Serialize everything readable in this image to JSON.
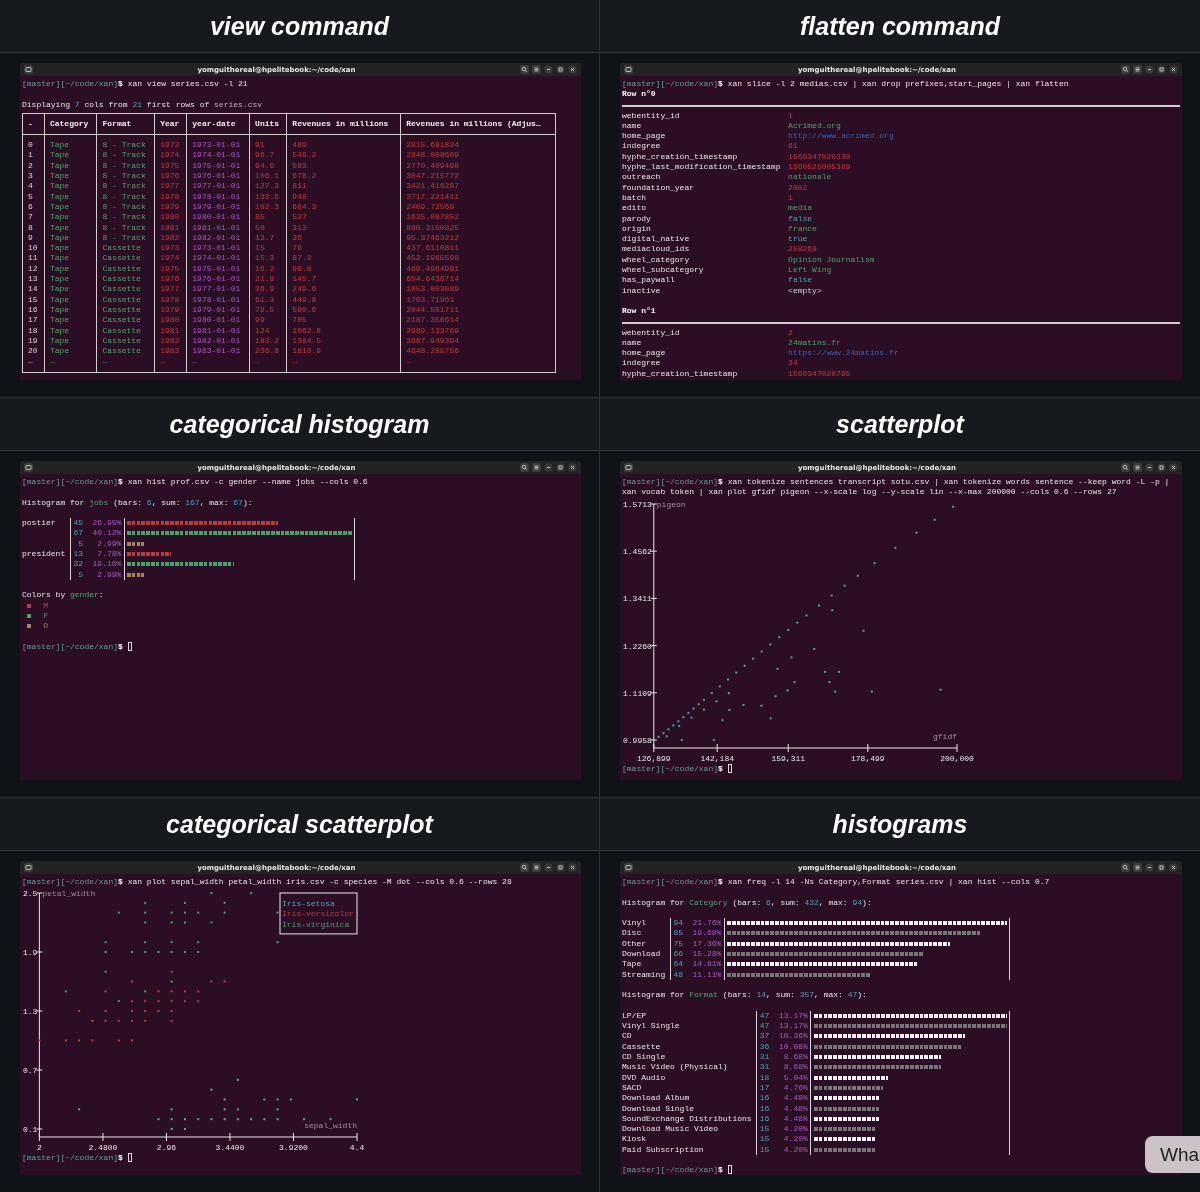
{
  "panels": [
    {
      "title": "view command",
      "terminal": {
        "title": "yomguithereal@hpelitebook:~/code/xan",
        "prompt": "[master][~/code/xan]$",
        "command": "xan view series.csv -l 21",
        "blocks": [
          {
            "kind": "text",
            "segments": [
              {
                "text": "Displaying ",
                "kind": "plain"
              },
              {
                "text": "7",
                "kind": "number"
              },
              {
                "text": " cols from ",
                "kind": "plain"
              },
              {
                "text": "21",
                "kind": "number"
              },
              {
                "text": " first rows of ",
                "kind": "plain"
              },
              {
                "text": "series.csv",
                "kind": "file"
              }
            ]
          },
          {
            "kind": "table",
            "columns": [
              {
                "header": "-",
                "kind": "index"
              },
              {
                "header": "Category",
                "kind": "string"
              },
              {
                "header": "Format",
                "kind": "string"
              },
              {
                "header": "Year",
                "kind": "int"
              },
              {
                "header": "year-date",
                "kind": "date"
              },
              {
                "header": "Units",
                "kind": "int"
              },
              {
                "header": "Revenues in millions",
                "kind": "int"
              },
              {
                "header": "Revenues in millions (Adjus…",
                "kind": "int"
              }
            ],
            "rows": [
              [
                "0",
                "Tape",
                "8 - Track",
                "1973",
                "1973-01-01",
                "91",
                "489",
                "2815.681824"
              ],
              [
                "1",
                "Tape",
                "8 - Track",
                "1974",
                "1974-01-01",
                "96.7",
                "549.2",
                "2848.008609"
              ],
              [
                "2",
                "Tape",
                "8 - Track",
                "1975",
                "1975-01-01",
                "94.6",
                "583",
                "2770.409498"
              ],
              [
                "3",
                "Tape",
                "8 - Track",
                "1976",
                "1976-01-01",
                "106.1",
                "678.2",
                "3047.215772"
              ],
              [
                "4",
                "Tape",
                "8 - Track",
                "1977",
                "1977-01-01",
                "127.3",
                "811",
                "3421.416287"
              ],
              [
                "5",
                "Tape",
                "8 - Track",
                "1978",
                "1978-01-01",
                "133.6",
                "948",
                "3717.221411"
              ],
              [
                "6",
                "Tape",
                "8 - Track",
                "1979",
                "1979-01-01",
                "102.3",
                "684.3",
                "2409.72569"
              ],
              [
                "7",
                "Tape",
                "8 - Track",
                "1980",
                "1980-01-01",
                "85",
                "527",
                "1635.087852"
              ],
              [
                "8",
                "Tape",
                "8 - Track",
                "1981",
                "1981-01-01",
                "50",
                "313",
                "880.3150825"
              ],
              [
                "9",
                "Tape",
                "8 - Track",
                "1982",
                "1982-01-01",
                "13.7",
                "36",
                "95.37463212"
              ],
              [
                "10",
                "Tape",
                "Cassette",
                "1973",
                "1973-01-01",
                "15",
                "76",
                "437.6110811"
              ],
              [
                "11",
                "Tape",
                "Cassette",
                "1974",
                "1974-01-01",
                "15.3",
                "87.2",
                "452.1965598"
              ],
              [
                "12",
                "Tape",
                "Cassette",
                "1975",
                "1975-01-01",
                "16.2",
                "98.8",
                "469.4964981"
              ],
              [
                "13",
                "Tape",
                "Cassette",
                "1976",
                "1976-01-01",
                "21.8",
                "145.7",
                "654.6436714"
              ],
              [
                "14",
                "Tape",
                "Cassette",
                "1977",
                "1977-01-01",
                "36.9",
                "249.6",
                "1053.003089"
              ],
              [
                "15",
                "Tape",
                "Cassette",
                "1978",
                "1978-01-01",
                "61.3",
                "449.8",
                "1763.71961"
              ],
              [
                "16",
                "Tape",
                "Cassette",
                "1979",
                "1979-01-01",
                "78.5",
                "580.6",
                "2044.551711"
              ],
              [
                "17",
                "Tape",
                "Cassette",
                "1980",
                "1980-01-01",
                "99",
                "705",
                "2187.356614"
              ],
              [
                "18",
                "Tape",
                "Cassette",
                "1981",
                "1981-01-01",
                "124",
                "1062.8",
                "2989.133769"
              ],
              [
                "19",
                "Tape",
                "Cassette",
                "1982",
                "1982-01-01",
                "183.2",
                "1384.5",
                "3667.949394"
              ],
              [
                "20",
                "Tape",
                "Cassette",
                "1983",
                "1983-01-01",
                "236.8",
                "1810.9",
                "4648.285756"
              ],
              [
                "…",
                "…",
                "…",
                "…",
                "…",
                "…",
                "…",
                "…"
              ]
            ]
          }
        ]
      }
    },
    {
      "title": "flatten command",
      "terminal": {
        "title": "yomguithereal@hpelitebook:~/code/xan",
        "prompt": "[master][~/code/xan]$",
        "command": "xan slice -l 2 medias.csv | xan drop prefixes,start_pages | xan flatten",
        "blocks": [
          {
            "kind": "record",
            "title": "Row n°0",
            "fields": [
              {
                "key": "webentity_id",
                "value": "1",
                "kind": "int"
              },
              {
                "key": "name",
                "value": "Acrimed.org",
                "kind": "string"
              },
              {
                "key": "home_page",
                "value": "http://www.acrimed.org",
                "kind": "url"
              },
              {
                "key": "indegree",
                "value": "61",
                "kind": "int"
              },
              {
                "key": "hyphe_creation_timestamp",
                "value": "1560347020330",
                "kind": "int"
              },
              {
                "key": "hyphe_last_modification_timestamp",
                "value": "1560526005389",
                "kind": "int"
              },
              {
                "key": "outreach",
                "value": "nationale",
                "kind": "string"
              },
              {
                "key": "foundation_year",
                "value": "2002",
                "kind": "int"
              },
              {
                "key": "batch",
                "value": "1",
                "kind": "int"
              },
              {
                "key": "edito",
                "value": "media",
                "kind": "string"
              },
              {
                "key": "parody",
                "value": "false",
                "kind": "bool"
              },
              {
                "key": "origin",
                "value": "france",
                "kind": "string"
              },
              {
                "key": "digital_native",
                "value": "true",
                "kind": "bool"
              },
              {
                "key": "mediacloud_ids",
                "value": "258269",
                "kind": "int"
              },
              {
                "key": "wheel_category",
                "value": "Opinion Journalism",
                "kind": "string"
              },
              {
                "key": "wheel_subcategory",
                "value": "Left Wing",
                "kind": "string"
              },
              {
                "key": "has_paywall",
                "value": "false",
                "kind": "bool"
              },
              {
                "key": "inactive",
                "value": "<empty>",
                "kind": "empty"
              }
            ]
          },
          {
            "kind": "record",
            "title": "Row n°1",
            "fields": [
              {
                "key": "webentity_id",
                "value": "2",
                "kind": "int"
              },
              {
                "key": "name",
                "value": "24matins.fr",
                "kind": "string"
              },
              {
                "key": "home_page",
                "value": "https://www.24matins.fr",
                "kind": "url"
              },
              {
                "key": "indegree",
                "value": "34",
                "kind": "int"
              },
              {
                "key": "hyphe_creation_timestamp",
                "value": "1560347020795",
                "kind": "int"
              }
            ]
          }
        ]
      }
    },
    {
      "title": "categorical histogram",
      "terminal": {
        "title": "yomguithereal@hpelitebook:~/code/xan",
        "prompt": "[master][~/code/xan]$",
        "command": "xan hist prof.csv -c gender --name jobs --cols 0.6",
        "blocks": [
          {
            "kind": "histogram",
            "heading": [
              {
                "text": "Histogram for ",
                "kind": "plain"
              },
              {
                "text": "jobs",
                "kind": "name"
              },
              {
                "text": " (bars: ",
                "kind": "plain"
              },
              {
                "text": "6",
                "kind": "number"
              },
              {
                "text": ", sum: ",
                "kind": "plain"
              },
              {
                "text": "167",
                "kind": "number"
              },
              {
                "text": ", max: ",
                "kind": "plain"
              },
              {
                "text": "67",
                "kind": "number"
              },
              {
                "text": "):",
                "kind": "plain"
              }
            ],
            "rows": [
              {
                "label": "postier",
                "count": "45",
                "percent": "26.95%",
                "level": 0.672,
                "color": "#c0393b"
              },
              {
                "count": "67",
                "percent": "40.12%",
                "level": 1,
                "color": "#3fa56b"
              },
              {
                "count": "5",
                "percent": "2.99%",
                "level": 0.075,
                "color": "#a88456"
              },
              {
                "label": "president",
                "count": "13",
                "percent": "7.78%",
                "level": 0.194,
                "color": "#c0393b"
              },
              {
                "count": "32",
                "percent": "19.16%",
                "level": 0.478,
                "color": "#3fa56b"
              },
              {
                "count": "5",
                "percent": "2.99%",
                "level": 0.075,
                "color": "#a88456"
              }
            ]
          },
          {
            "kind": "legend",
            "heading": [
              {
                "text": "Colors by ",
                "kind": "plain"
              },
              {
                "text": "gender",
                "kind": "name"
              },
              {
                "text": ":",
                "kind": "plain"
              }
            ],
            "items": [
              {
                "label": "M",
                "color": "#c0393b"
              },
              {
                "label": "F",
                "color": "#3fa56b"
              },
              {
                "label": "O",
                "color": "#a88456"
              }
            ]
          },
          {
            "kind": "prompt",
            "prompt": "[master][~/code/xan]$"
          }
        ]
      }
    },
    {
      "title": "scatterplot",
      "terminal": {
        "title": "yomguithereal@hpelitebook:~/code/xan",
        "prompt": "[master][~/code/xan]$",
        "command": "xan tokenize sentences transcript sotu.csv | xan tokenize words sentence --keep word -L -p | xan vocab token | xan plot gfidf pigeon --x-scale log --y-scale lin --x-max 200000 --cols 0.6 --rows 27",
        "blocks": [
          {
            "kind": "chart",
            "chart_data": {
              "type": "scatter",
              "xlabel": "gfidf",
              "ylabel": "pigeon",
              "xlim": [
                126899,
                200000
              ],
              "ylim": [
                0.9958,
                1.5713
              ],
              "xticks": [
                {
                  "value": 126899,
                  "label": "126,899"
                },
                {
                  "value": 142184,
                  "label": "142,184"
                },
                {
                  "value": 159311,
                  "label": "159,311"
                },
                {
                  "value": 178499,
                  "label": "178,499"
                },
                {
                  "value": 200000,
                  "label": "200,000"
                }
              ],
              "yticks": [
                0.9958,
                1.1109,
                {
                  "value": 1.226,
                  "label": "1.2260"
                },
                1.3411,
                1.4562,
                1.5713
              ],
              "series": [
                {
                  "color": "#4a9fb3",
                  "x": [
                    128059,
                    129230,
                    130410,
                    131602,
                    132805,
                    134019,
                    135244,
                    136480,
                    137727,
                    138986,
                    140896,
                    142831,
                    144794,
                    146784,
                    148800,
                    150845,
                    152917,
                    155020,
                    157147,
                    159307,
                    161496,
                    163714,
                    166721,
                    169783,
                    172901,
                    176077,
                    180127,
                    185113,
                    190235,
                    194610,
                    199086,
                    130000,
                    133000,
                    136000,
                    139000,
                    142000,
                    145000,
                    133663,
                    141391,
                    143422,
                    155083,
                    145122,
                    148523,
                    152850,
                    156239,
                    159157,
                    160832,
                    168154,
                    171568,
                    169233,
                    170629,
                    179486,
                    196034,
                    165591,
                    177456,
                    169931,
                    160097,
                    156720
                  ],
                  "values": [
                    1.0036,
                    1.0125,
                    1.0218,
                    1.0315,
                    1.0415,
                    1.0516,
                    1.0619,
                    1.0725,
                    1.0831,
                    1.0937,
                    1.11,
                    1.1264,
                    1.1432,
                    1.16,
                    1.177,
                    1.1942,
                    1.2114,
                    1.2289,
                    1.2464,
                    1.264,
                    1.2818,
                    1.2997,
                    1.3236,
                    1.3478,
                    1.372,
                    1.3964,
                    1.4271,
                    1.4642,
                    1.5016,
                    1.533,
                    1.5645,
                    1.005,
                    1.03,
                    1.05,
                    1.07,
                    1.09,
                    1.11,
                    0.9958,
                    0.9958,
                    1.0441,
                    1.0487,
                    1.0691,
                    1.0812,
                    1.0793,
                    1.1025,
                    1.1164,
                    1.1369,
                    1.1619,
                    1.1619,
                    1.1369,
                    1.1137,
                    1.1137,
                    1.1183,
                    1.2176,
                    1.2621,
                    1.3122,
                    1.1972,
                    1.1693
                  ]
                }
              ]
            }
          },
          {
            "kind": "prompt",
            "prompt": "[master][~/code/xan]$"
          }
        ]
      }
    },
    {
      "title": "categorical scatterplot",
      "terminal": {
        "title": "yomguithereal@hpelitebook:~/code/xan",
        "prompt": "[master][~/code/xan]$",
        "command": "xan plot sepal_width petal_width iris.csv -c species -M dot --cols 0.6 --rows 28",
        "blocks": [
          {
            "kind": "chart",
            "chart_data": {
              "type": "scatter",
              "xlabel": "sepal_width",
              "ylabel": "petal_width",
              "xlim": [
                2,
                4.4
              ],
              "ylim": [
                0.1,
                2.5
              ],
              "xticks": [
                {
                  "value": 2,
                  "label": "2"
                },
                {
                  "value": 2.48,
                  "label": "2.4800"
                },
                2.96,
                {
                  "value": 3.44,
                  "label": "3.4400"
                },
                {
                  "value": 3.92,
                  "label": "3.9200"
                },
                4.4
              ],
              "yticks": [
                0.1,
                0.7,
                1.3,
                1.9,
                2.5
              ],
              "series": [
                {
                  "name": "Iris-setosa",
                  "color": "#4aa9b9",
                  "x": [
                    3.5,
                    3.3,
                    3.4,
                    3.7,
                    3.8,
                    3.9,
                    4.4,
                    2.3,
                    3.0,
                    3.4,
                    3.5,
                    3.8,
                    2.9,
                    3.0,
                    3.1,
                    3.2,
                    3.3,
                    3.4,
                    3.5,
                    3.6,
                    3.7,
                    3.8,
                    4.0,
                    4.2,
                    3.0,
                    3.1
                  ],
                  "values": [
                    0.6,
                    0.5,
                    0.4,
                    0.4,
                    0.4,
                    0.4,
                    0.4,
                    0.3,
                    0.3,
                    0.3,
                    0.3,
                    0.3,
                    0.2,
                    0.2,
                    0.2,
                    0.2,
                    0.2,
                    0.2,
                    0.2,
                    0.2,
                    0.2,
                    0.2,
                    0.2,
                    0.2,
                    0.1,
                    0.1
                  ]
                },
                {
                  "name": "Iris-versicolor",
                  "color": "#c0393b",
                  "x": [
                    3.0,
                    2.7,
                    3.3,
                    3.4,
                    2.5,
                    2.9,
                    3.0,
                    3.1,
                    3.2,
                    2.7,
                    2.8,
                    2.9,
                    3.0,
                    3.1,
                    3.2,
                    2.3,
                    2.5,
                    2.7,
                    2.8,
                    2.9,
                    3.0,
                    2.4,
                    2.5,
                    2.6,
                    2.7,
                    2.8,
                    3.0,
                    2.0,
                    2.2,
                    2.3,
                    2.4,
                    2.6,
                    2.7
                  ],
                  "values": [
                    1.7,
                    1.6,
                    1.6,
                    1.6,
                    1.5,
                    1.5,
                    1.5,
                    1.5,
                    1.5,
                    1.4,
                    1.4,
                    1.4,
                    1.4,
                    1.4,
                    1.4,
                    1.3,
                    1.3,
                    1.3,
                    1.3,
                    1.3,
                    1.3,
                    1.2,
                    1.2,
                    1.2,
                    1.2,
                    1.2,
                    1.2,
                    1.0,
                    1.0,
                    1.0,
                    1.0,
                    1.0,
                    1.0
                  ]
                },
                {
                  "name": "Iris-virginica",
                  "color": "#3fa56b",
                  "x": [
                    3.3,
                    3.6,
                    2.8,
                    3.1,
                    3.4,
                    2.6,
                    2.8,
                    3.0,
                    3.1,
                    3.2,
                    3.4,
                    3.8,
                    2.8,
                    3.0,
                    3.1,
                    3.3,
                    2.5,
                    2.8,
                    3.0,
                    3.2,
                    3.8,
                    2.5,
                    2.7,
                    2.8,
                    2.9,
                    3.0,
                    3.1,
                    3.2,
                    2.5,
                    3.0,
                    2.2,
                    2.8,
                    2.6
                  ],
                  "values": [
                    2.5,
                    2.5,
                    2.4,
                    2.4,
                    2.4,
                    2.3,
                    2.3,
                    2.3,
                    2.3,
                    2.3,
                    2.3,
                    2.3,
                    2.2,
                    2.2,
                    2.2,
                    2.2,
                    2.0,
                    2.0,
                    2.0,
                    2.0,
                    2.0,
                    1.9,
                    1.9,
                    1.9,
                    1.9,
                    1.9,
                    1.9,
                    1.9,
                    1.7,
                    1.6,
                    1.5,
                    1.5,
                    1.4
                  ]
                }
              ]
            }
          },
          {
            "kind": "prompt",
            "prompt": "[master][~/code/xan]$"
          }
        ]
      }
    },
    {
      "title": "histograms",
      "terminal": {
        "title": "yomguithereal@hpelitebook:~/code/xan",
        "prompt": "[master][~/code/xan]$",
        "command": "xan freq -l 14 -Ns Category,Format series.csv | xan hist --cols 0.7",
        "blocks": [
          {
            "kind": "histogram",
            "heading": [
              {
                "text": "Histogram for ",
                "kind": "plain"
              },
              {
                "text": "Category",
                "kind": "name"
              },
              {
                "text": " (bars: ",
                "kind": "plain"
              },
              {
                "text": "6",
                "kind": "number"
              },
              {
                "text": ", sum: ",
                "kind": "plain"
              },
              {
                "text": "432",
                "kind": "number"
              },
              {
                "text": ", max: ",
                "kind": "plain"
              },
              {
                "text": "94",
                "kind": "number"
              },
              {
                "text": "):",
                "kind": "plain"
              }
            ],
            "rows": [
              {
                "label": "Vinyl",
                "count": "94",
                "percent": "21.76%",
                "level": 1
              },
              {
                "label": "Disc",
                "count": "85",
                "percent": "19.68%",
                "level": 0.904
              },
              {
                "label": "Other",
                "count": "75",
                "percent": "17.36%",
                "level": 0.798
              },
              {
                "label": "Download",
                "count": "66",
                "percent": "15.28%",
                "level": 0.702
              },
              {
                "label": "Tape",
                "count": "64",
                "percent": "14.81%",
                "level": 0.681
              },
              {
                "label": "Streaming",
                "count": "48",
                "percent": "11.11%",
                "level": 0.511
              }
            ]
          },
          {
            "kind": "histogram",
            "heading": [
              {
                "text": "Histogram for ",
                "kind": "plain"
              },
              {
                "text": "Format",
                "kind": "name"
              },
              {
                "text": " (bars: ",
                "kind": "plain"
              },
              {
                "text": "14",
                "kind": "number"
              },
              {
                "text": ", sum: ",
                "kind": "plain"
              },
              {
                "text": "357",
                "kind": "number"
              },
              {
                "text": ", max: ",
                "kind": "plain"
              },
              {
                "text": "47",
                "kind": "number"
              },
              {
                "text": "):",
                "kind": "plain"
              }
            ],
            "rows": [
              {
                "label": "LP/EP",
                "count": "47",
                "percent": "13.17%",
                "level": 1
              },
              {
                "label": "Vinyl Single",
                "count": "47",
                "percent": "13.17%",
                "level": 1
              },
              {
                "label": "CD",
                "count": "37",
                "percent": "10.36%",
                "level": 0.787
              },
              {
                "label": "Cassette",
                "count": "36",
                "percent": "10.08%",
                "level": 0.766
              },
              {
                "label": "CD Single",
                "count": "31",
                "percent": "8.68%",
                "level": 0.66
              },
              {
                "label": "Music Video (Physical)",
                "count": "31",
                "percent": "8.68%",
                "level": 0.66
              },
              {
                "label": "DVD Audio",
                "count": "18",
                "percent": "5.04%",
                "level": 0.383
              },
              {
                "label": "SACD",
                "count": "17",
                "percent": "4.76%",
                "level": 0.362
              },
              {
                "label": "Download Album",
                "count": "16",
                "percent": "4.48%",
                "level": 0.34
              },
              {
                "label": "Download Single",
                "count": "16",
                "percent": "4.48%",
                "level": 0.34
              },
              {
                "label": "SoundExchange Distributions",
                "count": "16",
                "percent": "4.48%",
                "level": 0.34
              },
              {
                "label": "Download Music Video",
                "count": "15",
                "percent": "4.20%",
                "level": 0.319
              },
              {
                "label": "Kiosk",
                "count": "15",
                "percent": "4.20%",
                "level": 0.319
              },
              {
                "label": "Paid Subscription",
                "count": "15",
                "percent": "4.20%",
                "level": 0.319
              }
            ]
          },
          {
            "kind": "prompt",
            "prompt": "[master][~/code/xan]$"
          }
        ]
      }
    }
  ],
  "floating_button": {
    "label": "Wha"
  }
}
